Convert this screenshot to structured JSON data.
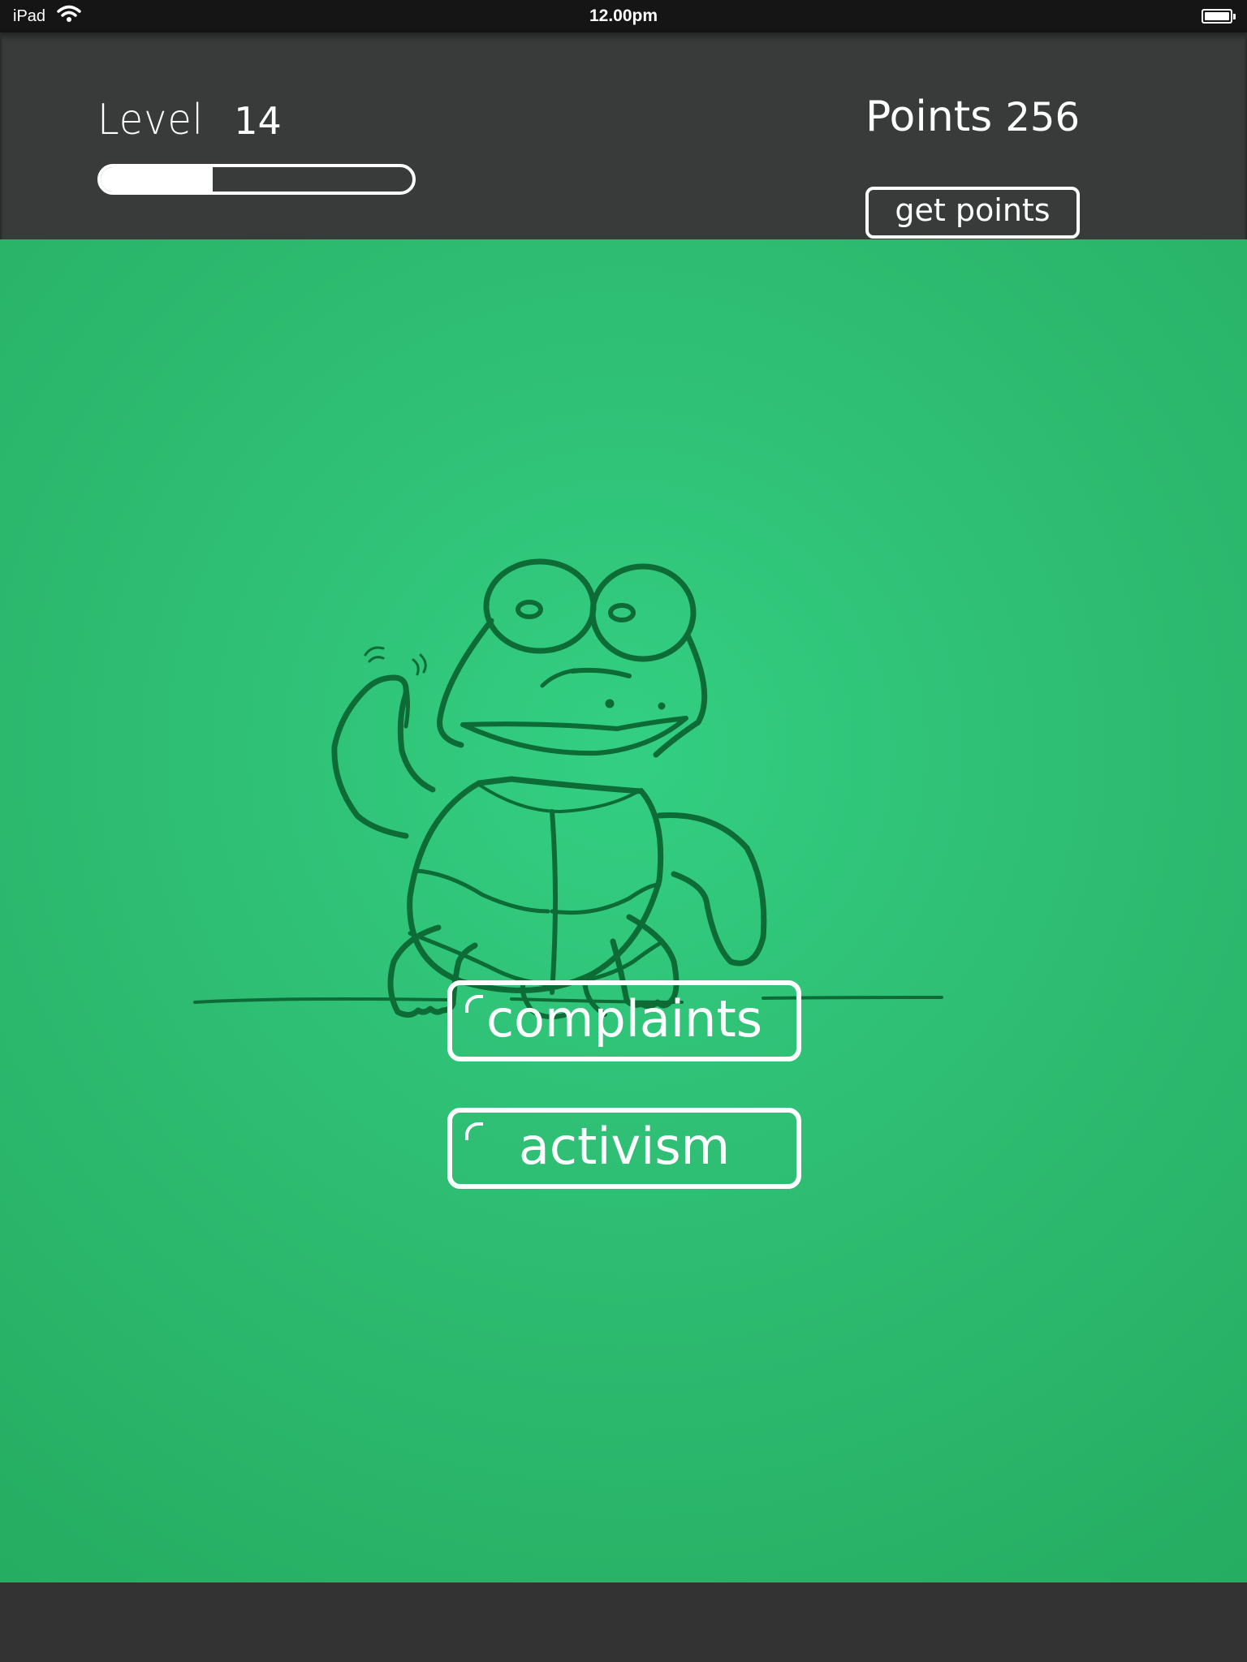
{
  "status_bar": {
    "device": "iPad",
    "time": "12.00pm",
    "icons": {
      "wifi": "wifi-icon",
      "battery": "battery-icon"
    }
  },
  "header": {
    "level_label": "Level",
    "level_value": "14",
    "level_progress_fraction": 0.36,
    "points_label": "Points",
    "points_value": "256",
    "get_points_label": "get points"
  },
  "illustration": "turtle-waving",
  "menu": {
    "complaints_label": "complaints",
    "activism_label": "activism"
  },
  "colors": {
    "stage_green": "#2ebd73",
    "line_green": "#0d6b36",
    "header_bg": "#393b3b"
  }
}
